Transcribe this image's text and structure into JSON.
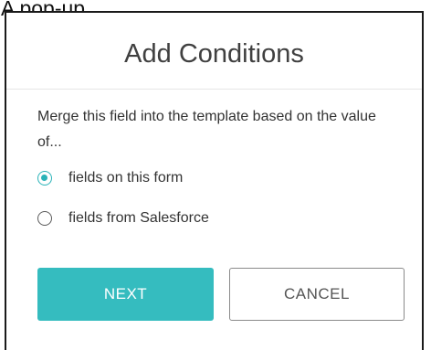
{
  "caption": "A pop-up",
  "dialog": {
    "title": "Add Conditions",
    "description": "Merge this field into the template based on the value of...",
    "options": [
      {
        "label": "fields on this form",
        "selected": true
      },
      {
        "label": "fields from Salesforce",
        "selected": false
      }
    ],
    "buttons": {
      "next_label": "NEXT",
      "cancel_label": "CANCEL"
    }
  },
  "colors": {
    "accent": "#35bcbf",
    "radio_selected": "#2ab3b8",
    "title_text": "#404040",
    "body_text": "#333333",
    "cancel_border": "#8a8a8a"
  }
}
